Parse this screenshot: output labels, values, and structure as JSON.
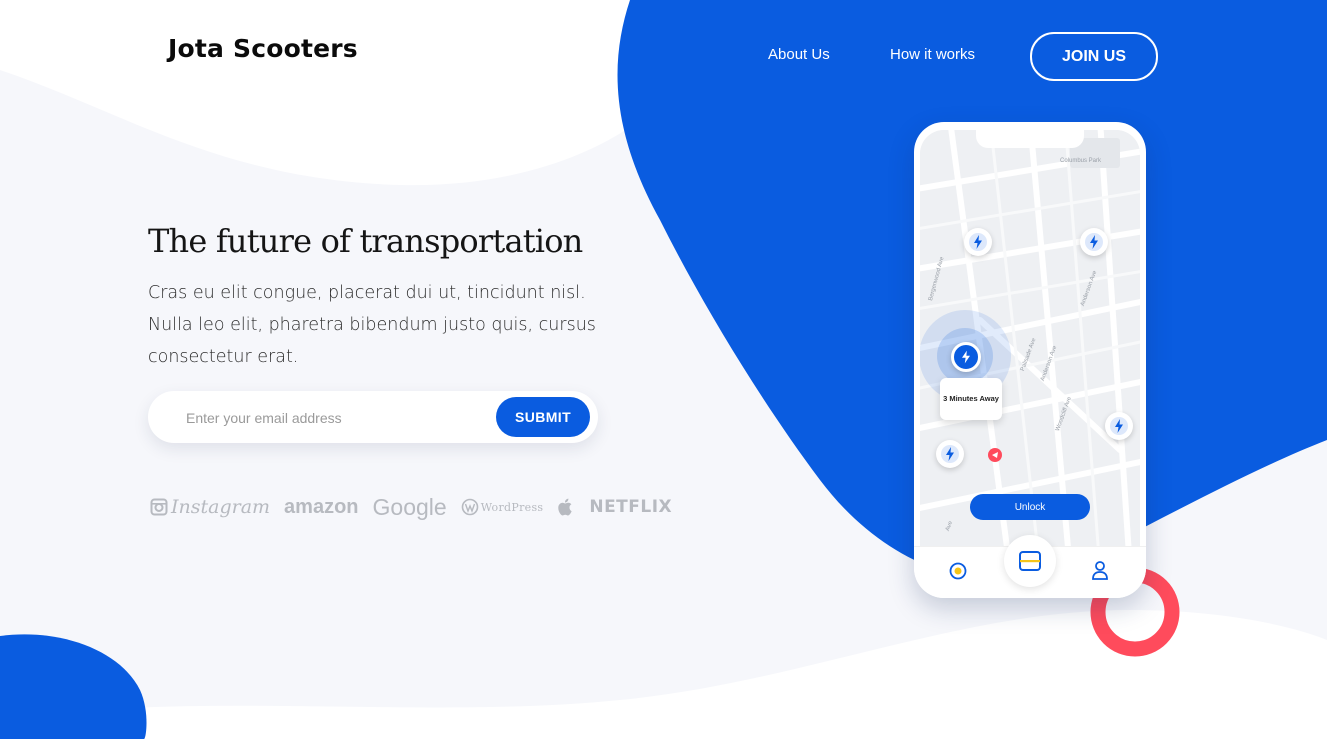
{
  "brand": {
    "name": "Jota Scooters"
  },
  "nav": {
    "about": "About Us",
    "how": "How it works",
    "join": "JOIN US"
  },
  "hero": {
    "title": "The future of transportation",
    "description": "Cras eu elit congue, placerat dui ut, tincidunt nisl. Nulla leo elit, pharetra bibendum justo quis, cursus consectetur erat."
  },
  "signup": {
    "placeholder": "Enter your email address",
    "submit": "SUBMIT"
  },
  "brands": {
    "instagram": "Instagram",
    "amazon": "amazon",
    "google": "Google",
    "wordpress": "WordPress",
    "netflix": "NETFLIX"
  },
  "phone": {
    "map_park": "Columbus Park",
    "map_streets": [
      "Bergenwood Ave",
      "Anderson Ave",
      "Palisade Ave",
      "Ave",
      "Anderson Ave",
      "Woodcliff Ave"
    ],
    "eta": "3 Minutes Away",
    "unlock": "Unlock"
  },
  "colors": {
    "accent": "#0a5ce0",
    "ring": "#ff4b5c",
    "light_bg": "#f6f7fb"
  }
}
